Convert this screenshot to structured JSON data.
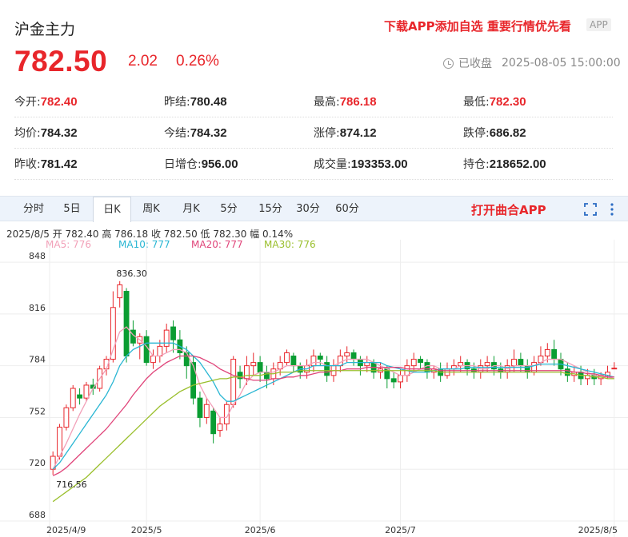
{
  "header": {
    "title": "沪金主力",
    "promo": "下载APP添加自选 重要行情优先看",
    "app_badge": "APP"
  },
  "quote": {
    "price": "782.50",
    "change": "2.02",
    "change_pct": "0.26%",
    "status": "已收盘",
    "datetime": "2025-08-05 15:00:00"
  },
  "stats": [
    [
      {
        "label": "今开:",
        "value": "782.40",
        "red": true
      },
      {
        "label": "昨结:",
        "value": "780.48"
      },
      {
        "label": "最高:",
        "value": "786.18",
        "red": true
      },
      {
        "label": "最低:",
        "value": "782.30",
        "red": true
      }
    ],
    [
      {
        "label": "均价:",
        "value": "784.32"
      },
      {
        "label": "今结:",
        "value": "784.32"
      },
      {
        "label": "涨停:",
        "value": "874.12"
      },
      {
        "label": "跌停:",
        "value": "686.82"
      }
    ],
    [
      {
        "label": "昨收:",
        "value": "781.42"
      },
      {
        "label": "日增仓:",
        "value": "956.00"
      },
      {
        "label": "成交量:",
        "value": "193353.00"
      },
      {
        "label": "持仓:",
        "value": "218652.00"
      }
    ]
  ],
  "tabs": [
    "分时",
    "5日",
    "日K",
    "周K",
    "月K",
    "5分",
    "15分",
    "30分",
    "60分"
  ],
  "active_tab": "日K",
  "open_app": "打开曲合APP",
  "bar_info": "2025/8/5  开 782.40  高 786.18  收 782.50  低 782.30  幅 0.14%",
  "ma_labels": [
    {
      "text": "MA5: 776",
      "color": "#f2a0b8"
    },
    {
      "text": "MA10: 777",
      "color": "#29b6d3"
    },
    {
      "text": "MA20: 777",
      "color": "#e0457a"
    },
    {
      "text": "MA30: 776",
      "color": "#9abf2c"
    }
  ],
  "colors": {
    "up": "#e8262b",
    "down": "#0a9d32",
    "accent": "#e8262b"
  },
  "chart_data": {
    "type": "candlestick",
    "y_ticks": [
      848,
      816,
      784,
      752,
      720,
      688
    ],
    "ylim": [
      688,
      852
    ],
    "x_ticks": [
      {
        "label": "2025/4/9",
        "index": 0
      },
      {
        "label": "2025/5",
        "index": 14
      },
      {
        "label": "2025/6",
        "index": 31
      },
      {
        "label": "2025/7",
        "index": 52
      },
      {
        "label": "2025/8/5",
        "index": 84
      }
    ],
    "annotations": [
      {
        "text": "836.30",
        "index": 9,
        "value": 836.3
      },
      {
        "text": "716.56",
        "index": 0,
        "value": 716.56
      }
    ],
    "candles": [
      [
        720,
        728,
        731,
        716.56
      ],
      [
        728,
        746,
        748,
        726
      ],
      [
        746,
        758,
        760,
        744
      ],
      [
        758,
        770,
        772,
        756
      ],
      [
        766,
        764,
        770,
        760
      ],
      [
        764,
        772,
        774,
        762
      ],
      [
        772,
        770,
        776,
        766
      ],
      [
        770,
        782,
        784,
        768
      ],
      [
        782,
        788,
        790,
        778
      ],
      [
        788,
        820,
        830,
        786
      ],
      [
        826,
        834,
        836.3,
        820
      ],
      [
        830,
        790,
        832,
        786
      ],
      [
        806,
        798,
        812,
        796
      ],
      [
        798,
        802,
        804,
        788
      ],
      [
        802,
        786,
        806,
        784
      ],
      [
        786,
        790,
        794,
        782
      ],
      [
        790,
        796,
        800,
        786
      ],
      [
        796,
        806,
        810,
        792
      ],
      [
        808,
        800,
        812,
        792
      ],
      [
        800,
        792,
        806,
        788
      ],
      [
        792,
        784,
        796,
        776
      ],
      [
        786,
        764,
        790,
        760
      ],
      [
        764,
        752,
        768,
        746
      ],
      [
        752,
        760,
        764,
        748
      ],
      [
        756,
        742,
        758,
        736
      ],
      [
        744,
        748,
        752,
        740
      ],
      [
        748,
        760,
        762,
        744
      ],
      [
        760,
        788,
        790,
        758
      ],
      [
        780,
        776,
        784,
        770
      ],
      [
        776,
        784,
        790,
        772
      ],
      [
        784,
        786,
        792,
        778
      ],
      [
        786,
        780,
        790,
        774
      ],
      [
        780,
        776,
        784,
        770
      ],
      [
        776,
        782,
        786,
        772
      ],
      [
        782,
        786,
        790,
        778
      ],
      [
        786,
        792,
        794,
        784
      ],
      [
        790,
        784,
        792,
        780
      ],
      [
        784,
        780,
        786,
        776
      ],
      [
        780,
        784,
        788,
        776
      ],
      [
        784,
        790,
        794,
        780
      ],
      [
        790,
        788,
        792,
        784
      ],
      [
        786,
        778,
        790,
        774
      ],
      [
        778,
        784,
        788,
        774
      ],
      [
        784,
        790,
        794,
        780
      ],
      [
        790,
        792,
        796,
        786
      ],
      [
        792,
        788,
        794,
        784
      ],
      [
        788,
        784,
        790,
        778
      ],
      [
        784,
        786,
        790,
        780
      ],
      [
        786,
        780,
        788,
        776
      ],
      [
        780,
        782,
        786,
        776
      ],
      [
        782,
        776,
        784,
        770
      ],
      [
        776,
        774,
        780,
        770
      ],
      [
        774,
        778,
        782,
        770
      ],
      [
        778,
        784,
        788,
        774
      ],
      [
        784,
        788,
        792,
        780
      ],
      [
        788,
        786,
        790,
        782
      ],
      [
        786,
        780,
        788,
        776
      ],
      [
        780,
        782,
        784,
        776
      ],
      [
        782,
        778,
        786,
        774
      ],
      [
        778,
        782,
        786,
        776
      ],
      [
        782,
        784,
        788,
        778
      ],
      [
        784,
        786,
        790,
        780
      ],
      [
        786,
        782,
        788,
        778
      ],
      [
        782,
        780,
        786,
        776
      ],
      [
        780,
        784,
        788,
        776
      ],
      [
        784,
        786,
        790,
        780
      ],
      [
        786,
        782,
        790,
        778
      ],
      [
        782,
        780,
        786,
        776
      ],
      [
        780,
        784,
        788,
        776
      ],
      [
        784,
        788,
        794,
        780
      ],
      [
        788,
        784,
        792,
        780
      ],
      [
        784,
        780,
        788,
        776
      ],
      [
        780,
        786,
        790,
        778
      ],
      [
        786,
        790,
        796,
        784
      ],
      [
        790,
        794,
        798,
        786
      ],
      [
        794,
        788,
        800,
        784
      ],
      [
        788,
        782,
        792,
        778
      ],
      [
        782,
        778,
        786,
        774
      ],
      [
        778,
        780,
        784,
        774
      ],
      [
        780,
        776,
        784,
        772
      ],
      [
        776,
        778,
        782,
        772
      ],
      [
        778,
        776,
        782,
        772
      ],
      [
        776,
        778,
        780,
        772
      ],
      [
        778,
        780,
        784,
        776
      ],
      [
        782.4,
        782.5,
        786.18,
        782.3
      ]
    ],
    "ma_series": [
      {
        "name": "MA5",
        "color": "#f2a0b8",
        "values": [
          720,
          728,
          736,
          745,
          754,
          762,
          770,
          776,
          782,
          794,
          805,
          808,
          803,
          800,
          796,
          790,
          790,
          792,
          794,
          794,
          792,
          784,
          772,
          764,
          758,
          752,
          752,
          760,
          766,
          774,
          778,
          780,
          780,
          780,
          782,
          784,
          784,
          784,
          784,
          786,
          786,
          784,
          784,
          786,
          788,
          788,
          788,
          788,
          786,
          784,
          782,
          780,
          778,
          778,
          780,
          782,
          784,
          784,
          782,
          782,
          782,
          784,
          784,
          784,
          782,
          782,
          784,
          784,
          782,
          784,
          784,
          784,
          784,
          786,
          788,
          788,
          788,
          786,
          784,
          782,
          780,
          778,
          777,
          777,
          776
        ]
      },
      {
        "name": "MA10",
        "color": "#29b6d3",
        "values": [
          720,
          724,
          730,
          736,
          742,
          748,
          754,
          760,
          766,
          774,
          784,
          790,
          794,
          796,
          798,
          798,
          798,
          798,
          798,
          796,
          794,
          790,
          786,
          780,
          774,
          766,
          762,
          762,
          764,
          766,
          768,
          770,
          772,
          774,
          776,
          778,
          780,
          782,
          782,
          784,
          784,
          784,
          784,
          784,
          786,
          786,
          786,
          786,
          786,
          786,
          784,
          783,
          782,
          781,
          780,
          780,
          780,
          781,
          782,
          782,
          782,
          782,
          783,
          783,
          783,
          783,
          783,
          783,
          783,
          783,
          783,
          783,
          784,
          785,
          785,
          785,
          785,
          784,
          783,
          782,
          781,
          780,
          779,
          778,
          777
        ]
      },
      {
        "name": "MA20",
        "color": "#e0457a",
        "values": [
          716,
          718,
          721,
          725,
          729,
          733,
          737,
          741,
          745,
          750,
          755,
          760,
          766,
          771,
          776,
          780,
          783,
          786,
          788,
          790,
          790,
          790,
          789,
          787,
          785,
          782,
          780,
          778,
          777,
          776,
          775,
          775,
          775,
          776,
          776,
          777,
          777,
          778,
          778,
          779,
          780,
          780,
          781,
          781,
          782,
          782,
          782,
          783,
          783,
          783,
          783,
          783,
          783,
          782,
          782,
          782,
          782,
          782,
          781,
          781,
          781,
          781,
          781,
          781,
          781,
          781,
          781,
          781,
          781,
          781,
          781,
          781,
          781,
          781,
          781,
          781,
          781,
          781,
          780,
          780,
          779,
          779,
          778,
          777,
          777
        ]
      },
      {
        "name": "MA30",
        "color": "#9abf2c",
        "values": [
          700,
          703,
          706,
          709,
          712,
          715,
          719,
          723,
          727,
          731,
          735,
          739,
          743,
          747,
          751,
          755,
          759,
          762,
          765,
          768,
          770,
          772,
          773,
          774,
          775,
          776,
          776,
          777,
          777,
          778,
          778,
          778,
          779,
          779,
          780,
          780,
          780,
          781,
          781,
          781,
          781,
          781,
          781,
          781,
          781,
          781,
          781,
          781,
          781,
          781,
          781,
          781,
          781,
          781,
          781,
          781,
          781,
          781,
          780,
          780,
          780,
          780,
          780,
          780,
          780,
          780,
          780,
          780,
          780,
          780,
          780,
          780,
          780,
          780,
          780,
          780,
          780,
          779,
          779,
          778,
          778,
          777,
          777,
          776,
          776
        ]
      }
    ]
  }
}
